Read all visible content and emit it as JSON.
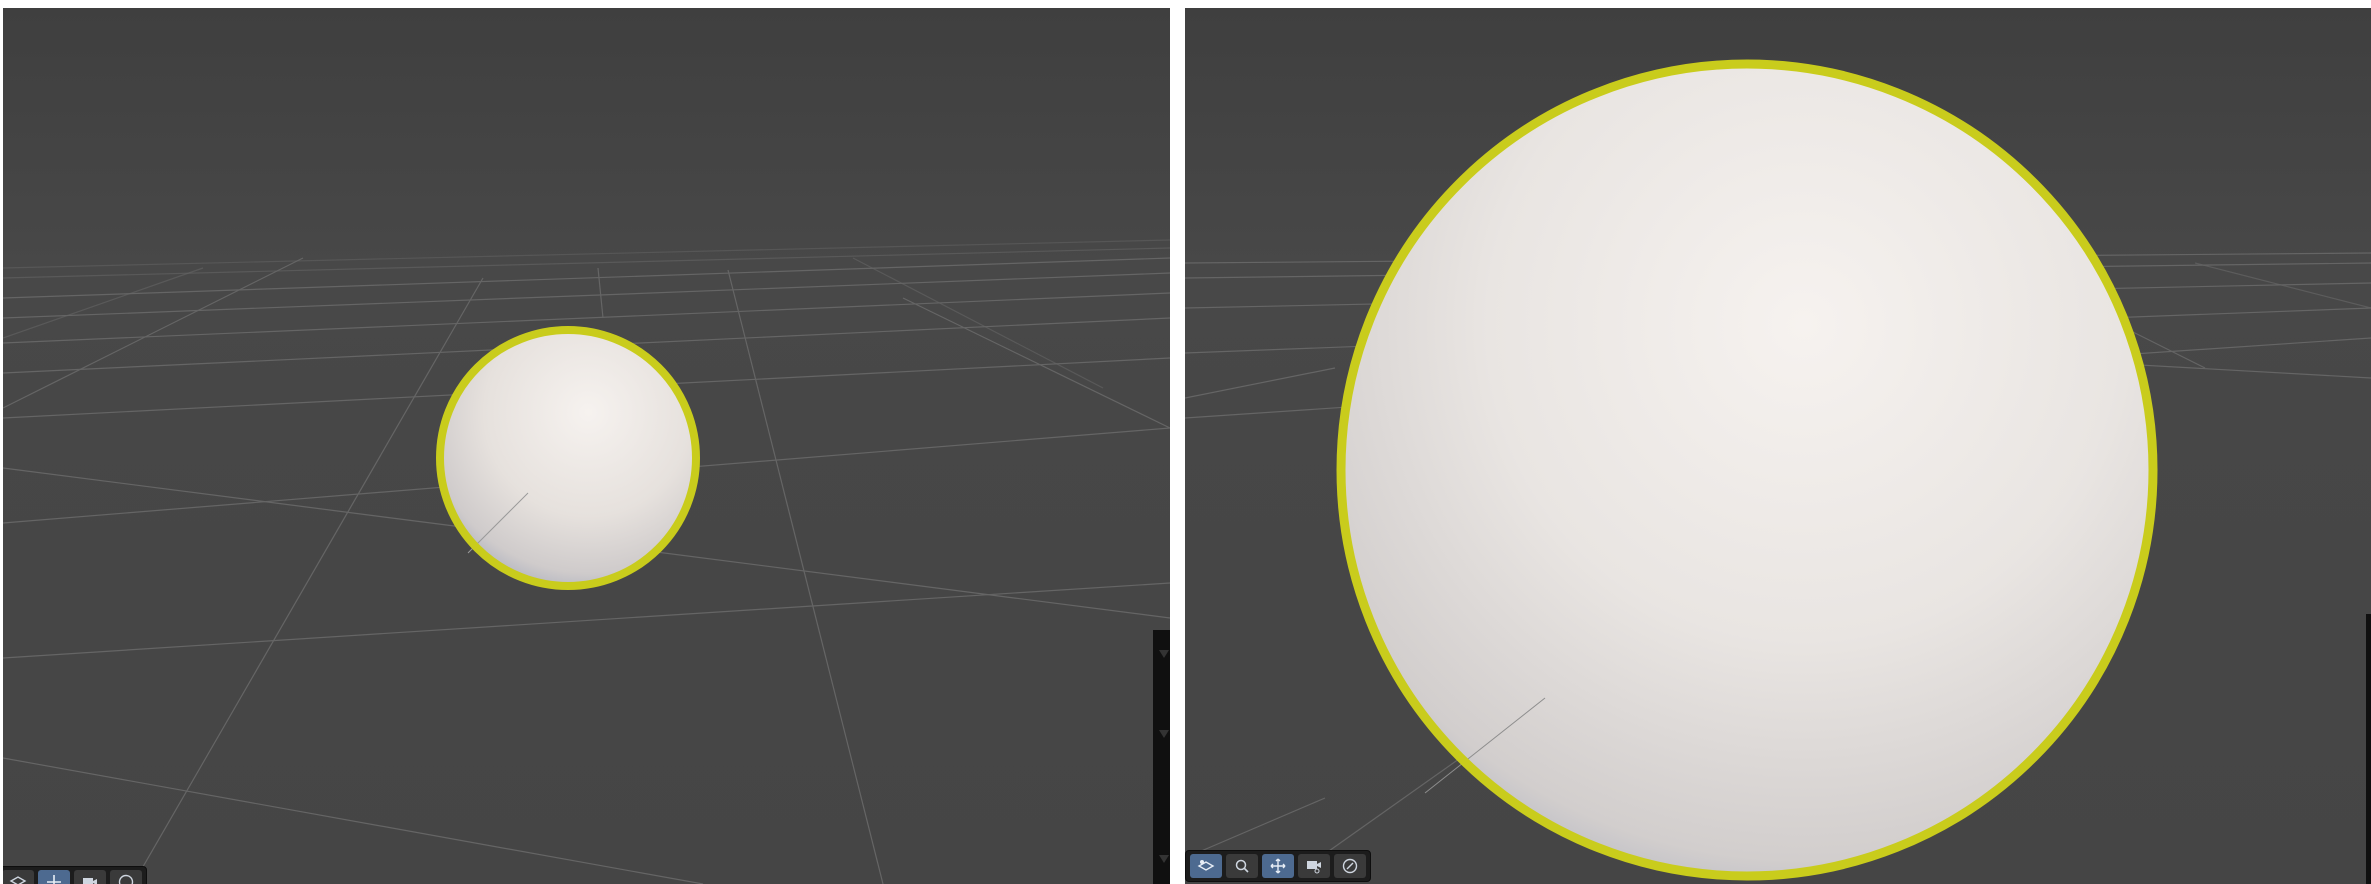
{
  "colors": {
    "background": "#454545",
    "grid_line": "#6a6a6a",
    "selection_outline": "#c9cc1c",
    "sphere_light": "#f5f1ee",
    "sphere_shadow": "#aeb3c2",
    "toolbar_bg": "#1c1c1c",
    "toolbar_active": "#4d6a90"
  },
  "viewports": [
    {
      "id": "left",
      "object": "sphere",
      "selected": true,
      "toolbar": [
        {
          "icon": "layers-icon",
          "active": false
        },
        {
          "icon": "move-icon",
          "active": true
        },
        {
          "icon": "camera-icon",
          "active": false
        },
        {
          "icon": "compass-icon",
          "active": false
        }
      ]
    },
    {
      "id": "right",
      "object": "sphere",
      "selected": true,
      "toolbar": [
        {
          "icon": "layers-icon",
          "active": true
        },
        {
          "icon": "search-icon",
          "active": false
        },
        {
          "icon": "move-icon",
          "active": true
        },
        {
          "icon": "camera-icon",
          "active": false
        },
        {
          "icon": "compass-icon",
          "active": false
        }
      ]
    }
  ]
}
